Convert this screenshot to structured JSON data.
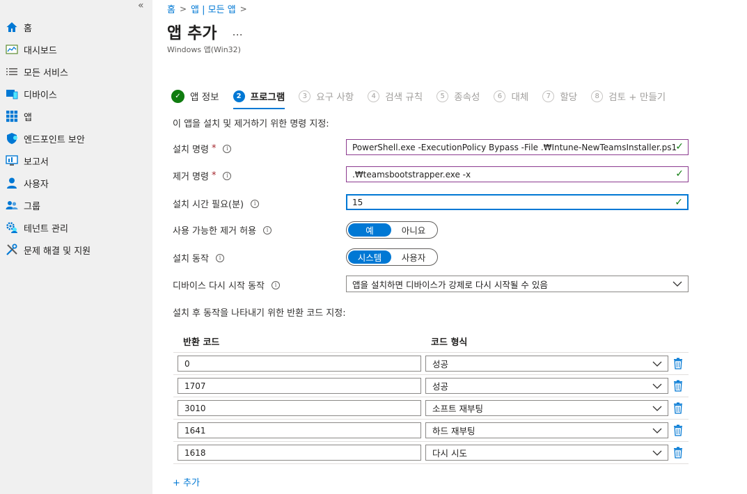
{
  "sidebar": {
    "collapse_glyph": "«",
    "items": [
      {
        "label": "홈",
        "icon": "home-icon"
      },
      {
        "label": "대시보드",
        "icon": "dashboard-icon"
      },
      {
        "label": "모든 서비스",
        "icon": "list-icon"
      },
      {
        "label": "디바이스",
        "icon": "devices-icon"
      },
      {
        "label": "앱",
        "icon": "apps-grid-icon"
      },
      {
        "label": "엔드포인트 보안",
        "icon": "shield-icon"
      },
      {
        "label": "보고서",
        "icon": "reports-icon"
      },
      {
        "label": "사용자",
        "icon": "user-icon"
      },
      {
        "label": "그룹",
        "icon": "group-icon"
      },
      {
        "label": "테넌트 관리",
        "icon": "tenant-gear-icon"
      },
      {
        "label": "문제 해결 및 지원",
        "icon": "tools-icon"
      }
    ]
  },
  "breadcrumb": {
    "items": [
      "홈",
      "앱 | 모든 앱"
    ],
    "separator": ">"
  },
  "header": {
    "title": "앱 추가",
    "more": "...",
    "subtitle": "Windows 앱(Win32)"
  },
  "steps": [
    {
      "num": "✓",
      "label": "앱 정보",
      "state": "done"
    },
    {
      "num": "2",
      "label": "프로그램",
      "state": "active"
    },
    {
      "num": "3",
      "label": "요구 사항",
      "state": "pending"
    },
    {
      "num": "4",
      "label": "검색 규칙",
      "state": "pending"
    },
    {
      "num": "5",
      "label": "종속성",
      "state": "pending"
    },
    {
      "num": "6",
      "label": "대체",
      "state": "pending"
    },
    {
      "num": "7",
      "label": "할당",
      "state": "pending"
    },
    {
      "num": "8",
      "label": "검토 + 만들기",
      "state": "pending"
    }
  ],
  "form": {
    "section_label": "이 앱을 설치 및 제거하기 위한 명령 지정:",
    "install_cmd": {
      "label": "설치 명령",
      "required": "*",
      "value": "PowerShell.exe -ExecutionPolicy Bypass -File .₩Intune-NewTeamsInstaller.ps1"
    },
    "uninstall_cmd": {
      "label": "제거 명령",
      "required": "*",
      "value": ".₩teamsbootstrapper.exe -x"
    },
    "install_time": {
      "label": "설치 시간 필요(분)",
      "value": "15"
    },
    "allow_uninstall": {
      "label": "사용 가능한 제거 허용",
      "options": [
        "예",
        "아니요"
      ],
      "selected": "예"
    },
    "install_behavior": {
      "label": "설치 동작",
      "options": [
        "시스템",
        "사용자"
      ],
      "selected": "시스템"
    },
    "restart_behavior": {
      "label": "디바이스 다시 시작 동작",
      "value": "앱을 설치하면 디바이스가 강제로 다시 시작될 수 있음"
    },
    "check_glyph": "✓",
    "info_glyph": "i"
  },
  "return_codes": {
    "section_label": "설치 후 동작을 나타내기 위한 반환 코드 지정:",
    "col_code": "반환 코드",
    "col_type": "코드 형식",
    "rows": [
      {
        "code": "0",
        "type": "성공"
      },
      {
        "code": "1707",
        "type": "성공"
      },
      {
        "code": "3010",
        "type": "소프트 재부팅"
      },
      {
        "code": "1641",
        "type": "하드 재부팅"
      },
      {
        "code": "1618",
        "type": "다시 시도"
      }
    ],
    "add_label": "+ 추가"
  },
  "colors": {
    "accent": "#0078d4",
    "success": "#107c10",
    "valid_border": "#8b3a8f",
    "sidebar_bg": "#f0f0f0"
  }
}
